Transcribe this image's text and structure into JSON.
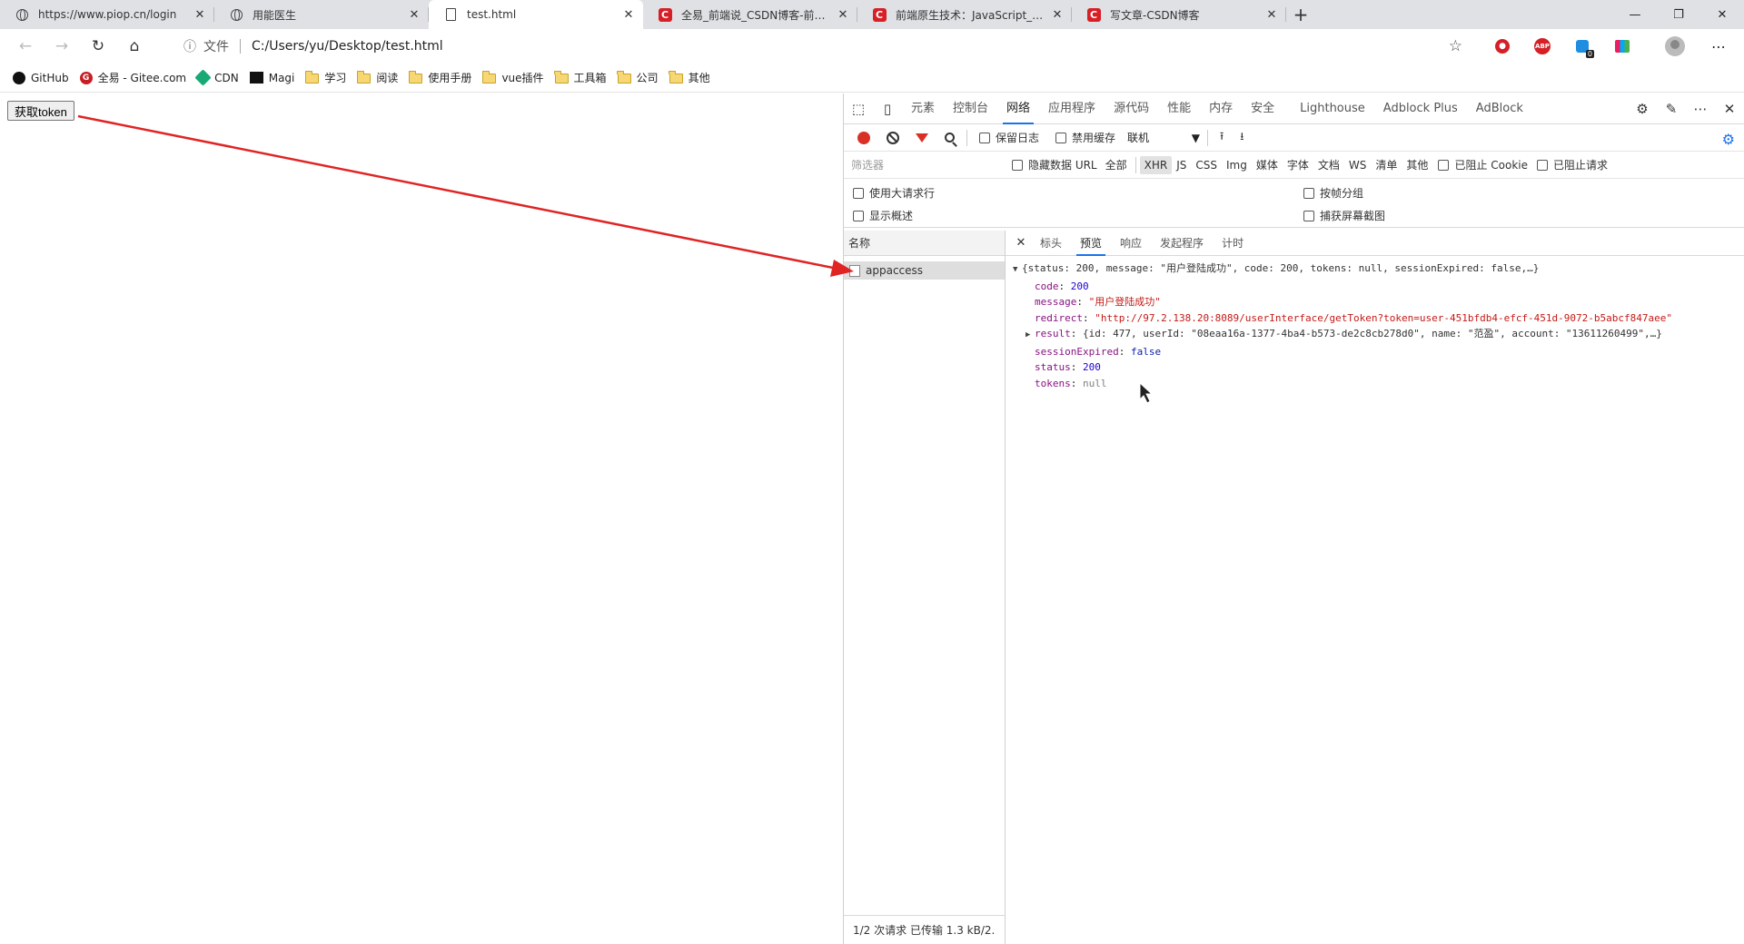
{
  "tabs": [
    {
      "title": "https://www.piop.cn/login",
      "icon": "globe-icon",
      "active": false
    },
    {
      "title": "用能医生",
      "icon": "globe-icon",
      "active": false
    },
    {
      "title": "test.html",
      "icon": "document-icon",
      "active": true
    },
    {
      "title": "全易_前端说_CSDN博客-前端原生",
      "icon": "csdn-icon",
      "active": false
    },
    {
      "title": "前端原生技术：JavaScript_全易_",
      "icon": "csdn-icon",
      "active": false
    },
    {
      "title": "写文章-CSDN博客",
      "icon": "csdn-icon",
      "active": false
    }
  ],
  "address": {
    "file_label": "文件",
    "url": "C:/Users/yu/Desktop/test.html"
  },
  "extensions": {
    "abp_label": "ABP",
    "blue_badge": "0"
  },
  "bookmarks": [
    {
      "label": "GitHub",
      "icon": "github-icon"
    },
    {
      "label": "全易 - Gitee.com",
      "icon": "gitee-icon"
    },
    {
      "label": "CDN",
      "icon": "cdn-icon"
    },
    {
      "label": "Magi",
      "icon": "magi-icon"
    },
    {
      "label": "学习",
      "icon": "folder-icon"
    },
    {
      "label": "阅读",
      "icon": "folder-icon"
    },
    {
      "label": "使用手册",
      "icon": "folder-icon"
    },
    {
      "label": "vue插件",
      "icon": "folder-icon"
    },
    {
      "label": "工具箱",
      "icon": "folder-icon"
    },
    {
      "label": "公司",
      "icon": "folder-icon"
    },
    {
      "label": "其他",
      "icon": "folder-icon"
    }
  ],
  "page": {
    "button_label": "获取token"
  },
  "devtools": {
    "tabs": [
      "元素",
      "控制台",
      "网络",
      "应用程序",
      "源代码",
      "性能",
      "内存",
      "安全",
      "Lighthouse",
      "Adblock Plus",
      "AdBlock"
    ],
    "active_tab": "网络",
    "toolbar": {
      "preserve_log": "保留日志",
      "disable_cache": "禁用缓存",
      "throttle": "联机"
    },
    "filter": {
      "placeholder": "筛选器",
      "hide_data_urls": "隐藏数据 URL",
      "types": [
        "全部",
        "XHR",
        "JS",
        "CSS",
        "Img",
        "媒体",
        "字体",
        "文档",
        "WS",
        "清单",
        "其他"
      ],
      "active_type": "XHR",
      "blocked_cookies": "已阻止 Cookie",
      "blocked_requests": "已阻止请求"
    },
    "options": {
      "large_rows": "使用大请求行",
      "overview": "显示概述",
      "group_by_frame": "按帧分组",
      "capture_screenshots": "捕获屏幕截图"
    },
    "request_list": {
      "header": "名称",
      "requests": [
        "appaccess"
      ],
      "footer": "1/2 次请求  已传输 1.3 kB/2."
    },
    "detail_tabs": [
      "标头",
      "预览",
      "响应",
      "发起程序",
      "计时"
    ],
    "active_detail_tab": "预览",
    "preview": {
      "summary": "{status: 200, message: \"用户登陆成功\", code: 200, tokens: null, sessionExpired: false,…}",
      "fields": [
        {
          "key": "code",
          "value": "200",
          "type": "num",
          "expandable": false
        },
        {
          "key": "message",
          "value": "\"用户登陆成功\"",
          "type": "str",
          "expandable": false
        },
        {
          "key": "redirect",
          "value": "\"http://97.2.138.20:8089/userInterface/getToken?token=user-451bfdb4-efcf-451d-9072-b5abcf847aee\"",
          "type": "str",
          "expandable": false
        },
        {
          "key": "result",
          "value": "{id: 477, userId: \"08eaa16a-1377-4ba4-b573-de2c8cb278d0\", name: \"范盈\", account: \"13611260499\",…}",
          "type": "sum",
          "expandable": true
        },
        {
          "key": "sessionExpired",
          "value": "false",
          "type": "kw",
          "expandable": false
        },
        {
          "key": "status",
          "value": "200",
          "type": "num",
          "expandable": false
        },
        {
          "key": "tokens",
          "value": "null",
          "type": "nul",
          "expandable": false
        }
      ]
    }
  },
  "annotation": {
    "arrow_color": "#e02424"
  }
}
